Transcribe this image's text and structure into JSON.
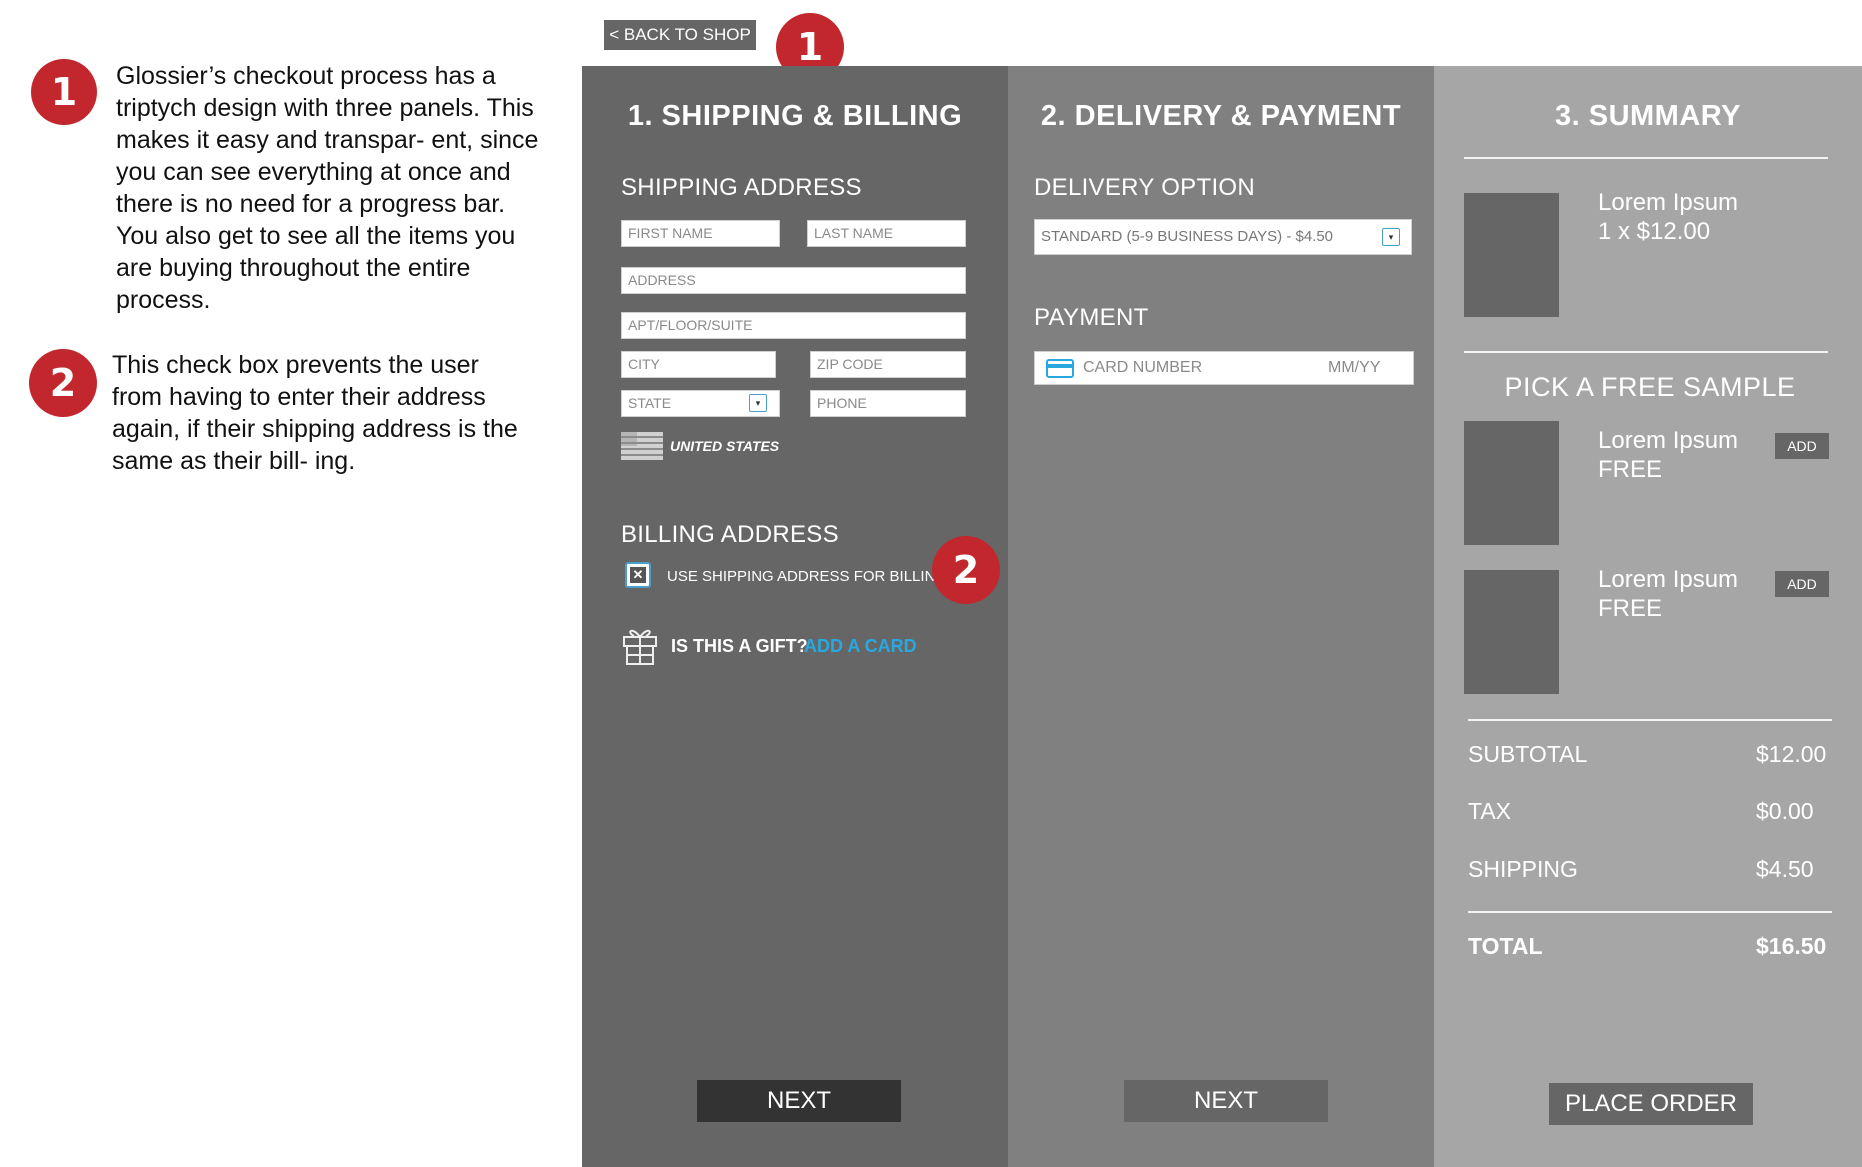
{
  "annotations": {
    "note1_badge": "1",
    "note1_text": "Glossier’s checkout process has a triptych design with three panels. This makes it easy and transpar- ent, since you can see everything at once and there is no need for a progress bar. You also get to see all the items you are buying throughout the entire process.",
    "note2_badge": "2",
    "note2_text": "This check box prevents the user from having to enter their address again, if their shipping address is the same as their bill- ing.",
    "marker1": "1",
    "marker2": "2"
  },
  "header": {
    "back_label": "< BACK TO SHOP"
  },
  "panel1": {
    "title": "1. SHIPPING & BILLING",
    "shipping_heading": "SHIPPING ADDRESS",
    "placeholders": {
      "first_name": "FIRST NAME",
      "last_name": "LAST NAME",
      "address": "ADDRESS",
      "apt": "APT/FLOOR/SUITE",
      "city": "CITY",
      "zip": "ZIP CODE",
      "state": "STATE",
      "phone": "PHONE"
    },
    "country": "UNITED STATES",
    "billing_heading": "BILLING ADDRESS",
    "checkbox_label": "USE SHIPPING ADDRESS FOR BILLING",
    "gift_label": "IS THIS A GIFT?",
    "gift_link": "ADD A CARD",
    "next_label": "NEXT"
  },
  "panel2": {
    "title": "2. DELIVERY & PAYMENT",
    "delivery_heading": "DELIVERY OPTION",
    "delivery_selected": "STANDARD (5-9 BUSINESS DAYS) - $4.50",
    "payment_heading": "PAYMENT",
    "card_placeholder": "CARD NUMBER",
    "expiry_placeholder": "MM/YY",
    "next_label": "NEXT"
  },
  "panel3": {
    "title": "3. SUMMARY",
    "item": {
      "name": "Lorem Ipsum",
      "qty_price": "1 x $12.00"
    },
    "samples_heading": "PICK A FREE SAMPLE",
    "samples": [
      {
        "name": "Lorem Ipsum",
        "price": "FREE",
        "add_label": "ADD"
      },
      {
        "name": "Lorem Ipsum",
        "price": "FREE",
        "add_label": "ADD"
      }
    ],
    "subtotal_label": "SUBTOTAL",
    "subtotal_value": "$12.00",
    "tax_label": "TAX",
    "tax_value": "$0.00",
    "shipping_label": "SHIPPING",
    "shipping_value": "$4.50",
    "total_label": "TOTAL",
    "total_value": "$16.50",
    "place_order_label": "PLACE ORDER"
  },
  "colors": {
    "annotation_red": "#c1272d",
    "panel1_bg": "#666666",
    "panel2_bg": "#808080",
    "panel3_bg": "#a6a6a6",
    "link_blue": "#29a8e0"
  }
}
